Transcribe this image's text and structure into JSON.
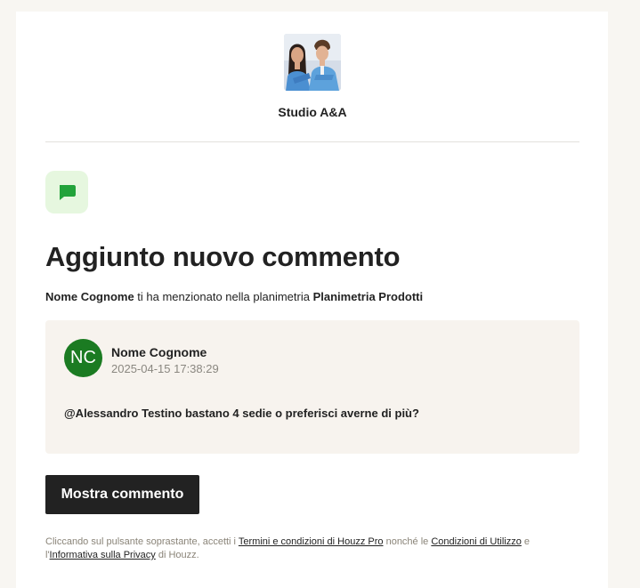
{
  "header": {
    "studio_name": "Studio A&A",
    "logo_icon": "studio-photo-logo"
  },
  "notification": {
    "badge_icon": "chat-bubble-icon",
    "badge_bg": "#e6f7df",
    "badge_color": "#22a33a",
    "title": "Aggiunto nuovo commento",
    "subtitle": {
      "author": "Nome Cognome",
      "middle": "ti ha menzionato nella planimetria",
      "plan": "Planimetria Prodotti"
    }
  },
  "comment": {
    "avatar_initials": "NC",
    "avatar_color": "#1b7b22",
    "author": "Nome Cognome",
    "timestamp": "2025-04-15 17:38:29",
    "text": "@Alessandro Testino bastano 4 sedie o preferisci averne di più?"
  },
  "cta": {
    "label": "Mostra commento"
  },
  "legal": {
    "before_terms": "Cliccando sul pulsante soprastante, accetti i",
    "terms_link": "Termini e condizioni di Houzz Pro",
    "between": "nonché le",
    "conditions_link": "Condizioni di Utilizzo",
    "before_privacy": "e l'",
    "privacy_link": "Informativa sulla Privacy",
    "after_privacy": "di Houzz."
  }
}
